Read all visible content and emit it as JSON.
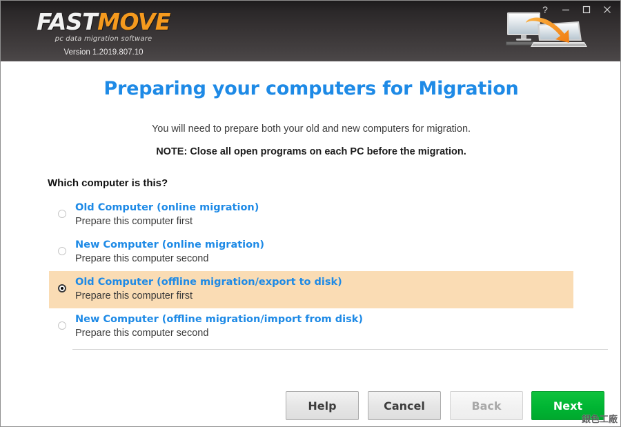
{
  "window": {
    "logo": {
      "name_part1": "FAST",
      "name_part2": "MOVE",
      "tagline": "pc data migration software",
      "version": "Version 1.2019.807.10"
    },
    "controls": {
      "help_label": "?",
      "minimize_label": "Minimize",
      "maximize_label": "Maximize",
      "close_label": "Close"
    },
    "header_icon": "computer-to-laptop-migration-icon"
  },
  "main": {
    "title": "Preparing your computers for Migration",
    "subtitle": "You will need to prepare both your old and new computers for migration.",
    "note": "NOTE: Close all open programs on each PC before the migration.",
    "question": "Which computer is this?",
    "options": [
      {
        "title": "Old Computer (online migration)",
        "subtitle": "Prepare this computer first",
        "selected": false
      },
      {
        "title": "New Computer (online migration)",
        "subtitle": "Prepare this computer second",
        "selected": false
      },
      {
        "title": "Old Computer (offline migration/export to disk)",
        "subtitle": "Prepare this computer first",
        "selected": true
      },
      {
        "title": "New Computer (offline migration/import from disk)",
        "subtitle": "Prepare this computer second",
        "selected": false
      }
    ]
  },
  "footer": {
    "help_button": "Help",
    "cancel_button": "Cancel",
    "back_button": "Back",
    "next_button": "Next"
  },
  "watermark": "銀色工廠",
  "colors": {
    "accent_blue": "#1e8ae6",
    "logo_orange": "#f59a1e",
    "selected_row": "#fadcb4",
    "next_green": "#00b533",
    "header_dark": "#2b2829"
  }
}
